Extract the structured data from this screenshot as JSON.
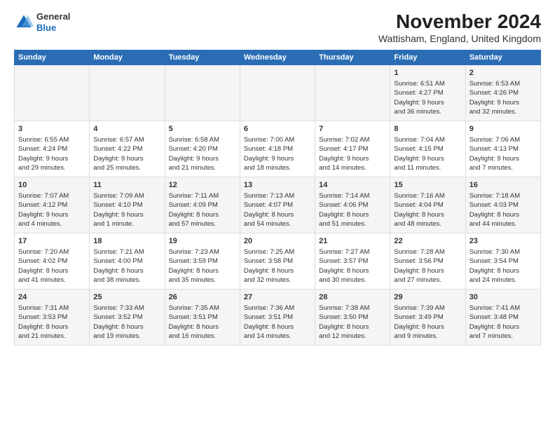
{
  "header": {
    "logo": {
      "general": "General",
      "blue": "Blue"
    },
    "title": "November 2024",
    "location": "Wattisham, England, United Kingdom"
  },
  "calendar": {
    "weekdays": [
      "Sunday",
      "Monday",
      "Tuesday",
      "Wednesday",
      "Thursday",
      "Friday",
      "Saturday"
    ],
    "weeks": [
      [
        {
          "day": "",
          "content": ""
        },
        {
          "day": "",
          "content": ""
        },
        {
          "day": "",
          "content": ""
        },
        {
          "day": "",
          "content": ""
        },
        {
          "day": "",
          "content": ""
        },
        {
          "day": "1",
          "content": "Sunrise: 6:51 AM\nSunset: 4:27 PM\nDaylight: 9 hours\nand 36 minutes."
        },
        {
          "day": "2",
          "content": "Sunrise: 6:53 AM\nSunset: 4:26 PM\nDaylight: 9 hours\nand 32 minutes."
        }
      ],
      [
        {
          "day": "3",
          "content": "Sunrise: 6:55 AM\nSunset: 4:24 PM\nDaylight: 9 hours\nand 29 minutes."
        },
        {
          "day": "4",
          "content": "Sunrise: 6:57 AM\nSunset: 4:22 PM\nDaylight: 9 hours\nand 25 minutes."
        },
        {
          "day": "5",
          "content": "Sunrise: 6:58 AM\nSunset: 4:20 PM\nDaylight: 9 hours\nand 21 minutes."
        },
        {
          "day": "6",
          "content": "Sunrise: 7:00 AM\nSunset: 4:18 PM\nDaylight: 9 hours\nand 18 minutes."
        },
        {
          "day": "7",
          "content": "Sunrise: 7:02 AM\nSunset: 4:17 PM\nDaylight: 9 hours\nand 14 minutes."
        },
        {
          "day": "8",
          "content": "Sunrise: 7:04 AM\nSunset: 4:15 PM\nDaylight: 9 hours\nand 11 minutes."
        },
        {
          "day": "9",
          "content": "Sunrise: 7:06 AM\nSunset: 4:13 PM\nDaylight: 9 hours\nand 7 minutes."
        }
      ],
      [
        {
          "day": "10",
          "content": "Sunrise: 7:07 AM\nSunset: 4:12 PM\nDaylight: 9 hours\nand 4 minutes."
        },
        {
          "day": "11",
          "content": "Sunrise: 7:09 AM\nSunset: 4:10 PM\nDaylight: 9 hours\nand 1 minute."
        },
        {
          "day": "12",
          "content": "Sunrise: 7:11 AM\nSunset: 4:09 PM\nDaylight: 8 hours\nand 57 minutes."
        },
        {
          "day": "13",
          "content": "Sunrise: 7:13 AM\nSunset: 4:07 PM\nDaylight: 8 hours\nand 54 minutes."
        },
        {
          "day": "14",
          "content": "Sunrise: 7:14 AM\nSunset: 4:06 PM\nDaylight: 8 hours\nand 51 minutes."
        },
        {
          "day": "15",
          "content": "Sunrise: 7:16 AM\nSunset: 4:04 PM\nDaylight: 8 hours\nand 48 minutes."
        },
        {
          "day": "16",
          "content": "Sunrise: 7:18 AM\nSunset: 4:03 PM\nDaylight: 8 hours\nand 44 minutes."
        }
      ],
      [
        {
          "day": "17",
          "content": "Sunrise: 7:20 AM\nSunset: 4:02 PM\nDaylight: 8 hours\nand 41 minutes."
        },
        {
          "day": "18",
          "content": "Sunrise: 7:21 AM\nSunset: 4:00 PM\nDaylight: 8 hours\nand 38 minutes."
        },
        {
          "day": "19",
          "content": "Sunrise: 7:23 AM\nSunset: 3:59 PM\nDaylight: 8 hours\nand 35 minutes."
        },
        {
          "day": "20",
          "content": "Sunrise: 7:25 AM\nSunset: 3:58 PM\nDaylight: 8 hours\nand 32 minutes."
        },
        {
          "day": "21",
          "content": "Sunrise: 7:27 AM\nSunset: 3:57 PM\nDaylight: 8 hours\nand 30 minutes."
        },
        {
          "day": "22",
          "content": "Sunrise: 7:28 AM\nSunset: 3:56 PM\nDaylight: 8 hours\nand 27 minutes."
        },
        {
          "day": "23",
          "content": "Sunrise: 7:30 AM\nSunset: 3:54 PM\nDaylight: 8 hours\nand 24 minutes."
        }
      ],
      [
        {
          "day": "24",
          "content": "Sunrise: 7:31 AM\nSunset: 3:53 PM\nDaylight: 8 hours\nand 21 minutes."
        },
        {
          "day": "25",
          "content": "Sunrise: 7:33 AM\nSunset: 3:52 PM\nDaylight: 8 hours\nand 19 minutes."
        },
        {
          "day": "26",
          "content": "Sunrise: 7:35 AM\nSunset: 3:51 PM\nDaylight: 8 hours\nand 16 minutes."
        },
        {
          "day": "27",
          "content": "Sunrise: 7:36 AM\nSunset: 3:51 PM\nDaylight: 8 hours\nand 14 minutes."
        },
        {
          "day": "28",
          "content": "Sunrise: 7:38 AM\nSunset: 3:50 PM\nDaylight: 8 hours\nand 12 minutes."
        },
        {
          "day": "29",
          "content": "Sunrise: 7:39 AM\nSunset: 3:49 PM\nDaylight: 8 hours\nand 9 minutes."
        },
        {
          "day": "30",
          "content": "Sunrise: 7:41 AM\nSunset: 3:48 PM\nDaylight: 8 hours\nand 7 minutes."
        }
      ]
    ]
  }
}
